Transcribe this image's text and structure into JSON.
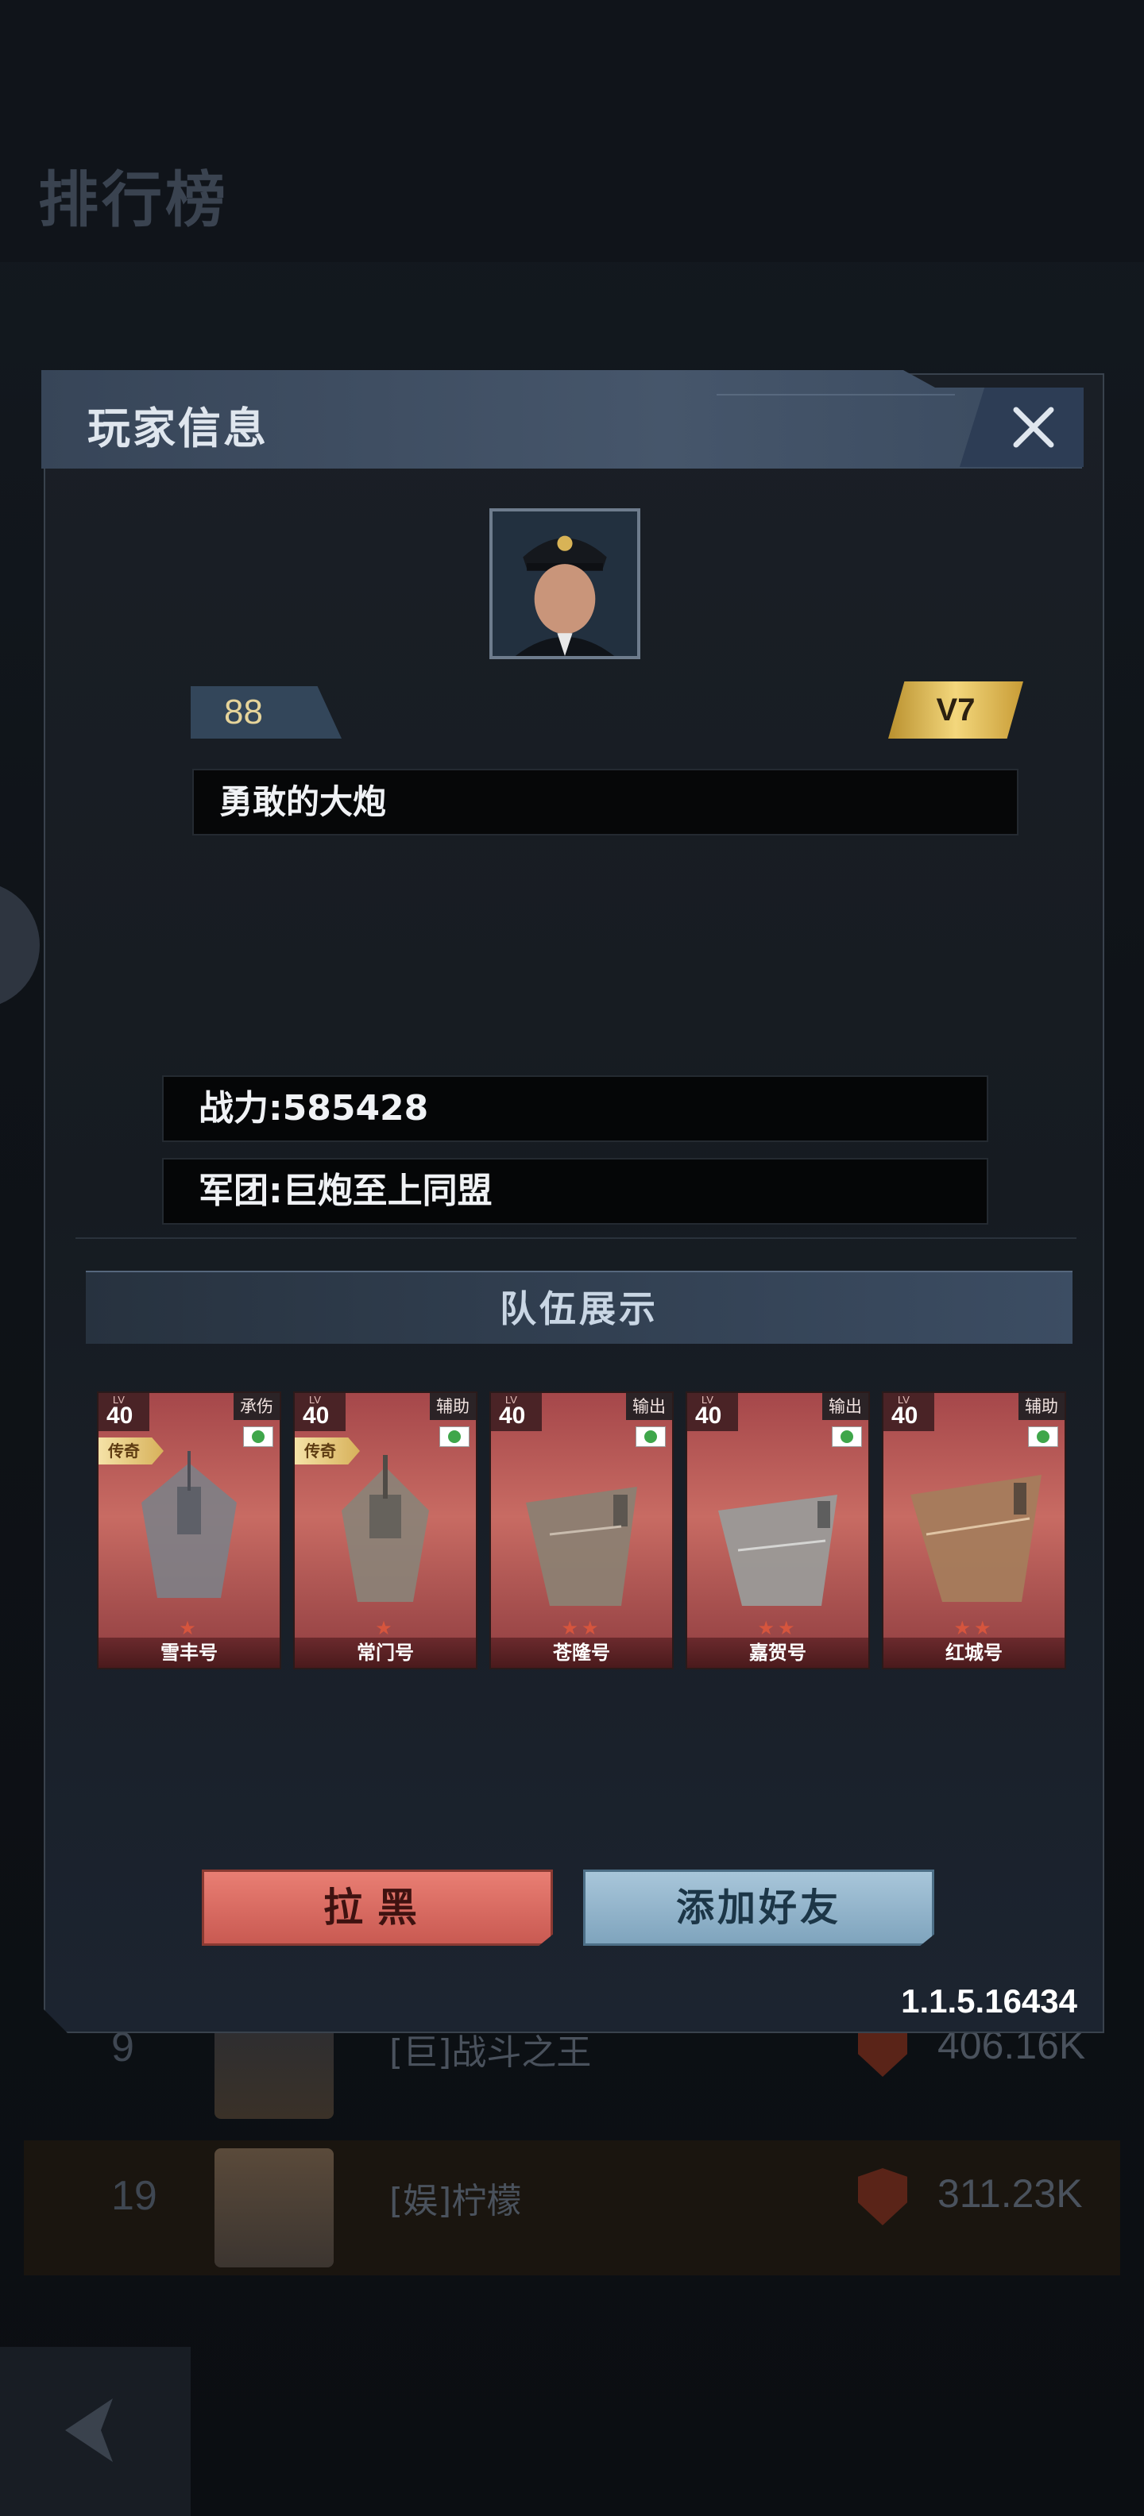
{
  "background": {
    "title": "排行榜",
    "rows": [
      {
        "rank": "9",
        "name": "[巨]战斗之王",
        "power": "406.16K"
      },
      {
        "rank": "19",
        "name": "[娱]柠檬",
        "power": "311.23K"
      }
    ]
  },
  "dialog": {
    "title": "玩家信息",
    "level": "88",
    "vip": "V7",
    "player_name": "勇敢的大炮",
    "power": "战力:585428",
    "legion": "军团:巨炮至上同盟",
    "team_header": "队伍展示",
    "ships": [
      {
        "lv_label": "LV",
        "level": "40",
        "role": "承伤",
        "tag": "传奇",
        "name": "雪丰号",
        "stars": "★"
      },
      {
        "lv_label": "LV",
        "level": "40",
        "role": "辅助",
        "tag": "传奇",
        "name": "常门号",
        "stars": "★"
      },
      {
        "lv_label": "LV",
        "level": "40",
        "role": "输出",
        "tag": "",
        "name": "苍隆号",
        "stars": "★★"
      },
      {
        "lv_label": "LV",
        "level": "40",
        "role": "输出",
        "tag": "",
        "name": "嘉贺号",
        "stars": "★★"
      },
      {
        "lv_label": "LV",
        "level": "40",
        "role": "辅助",
        "tag": "",
        "name": "红城号",
        "stars": "★★"
      }
    ],
    "block_button": "拉黑",
    "add_friend_button": "添加好友",
    "version": "1.1.5.16434"
  },
  "icons": {
    "close": "close-icon",
    "back": "back-arrow-icon",
    "flag": "flag-icon",
    "power": "shield-icon"
  },
  "colors": {
    "block": "#d96a61",
    "add_friend": "#92b4cb",
    "vip": "#e9c767",
    "title_bar": "#415166"
  }
}
